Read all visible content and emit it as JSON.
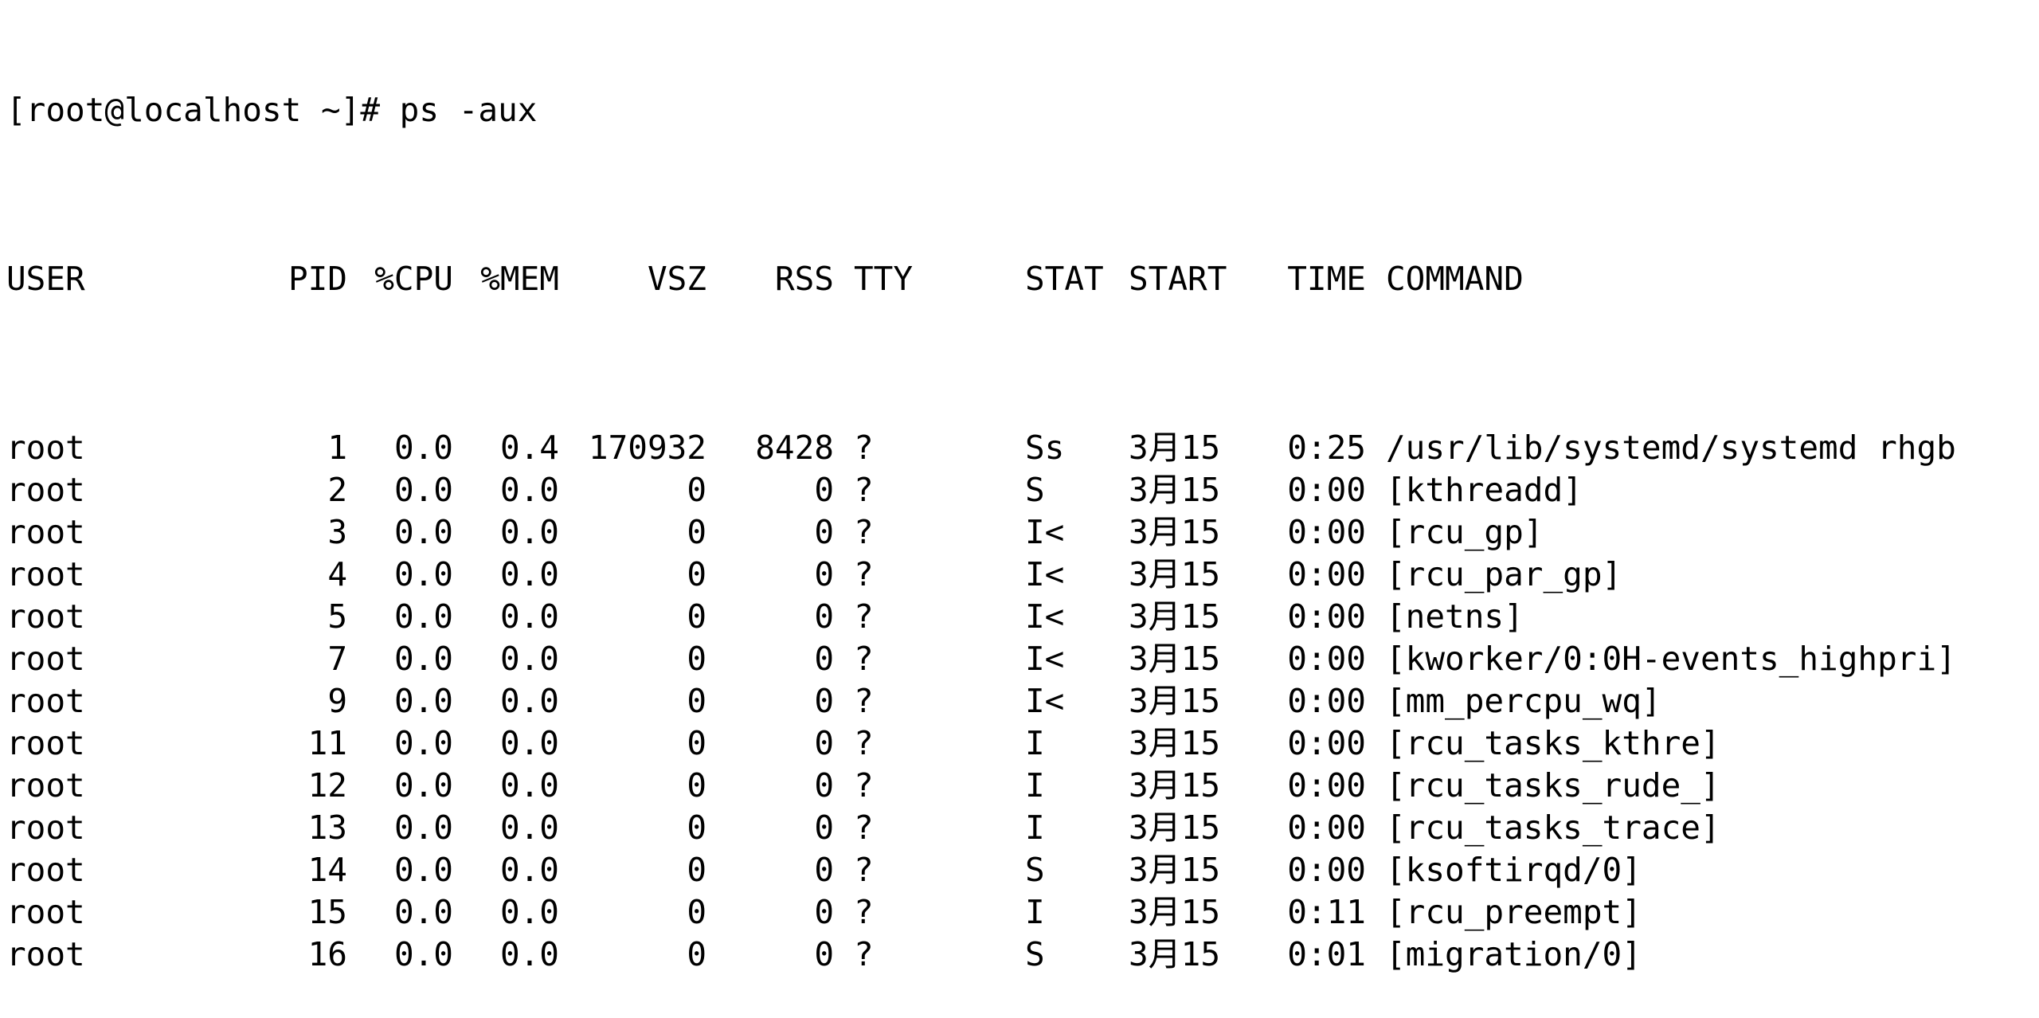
{
  "terminal": {
    "prompt": "[root@localhost ~]# ps -aux",
    "headers": {
      "user": "USER",
      "pid": "PID",
      "cpu": "%CPU",
      "mem": "%MEM",
      "vsz": "VSZ",
      "rss": "RSS",
      "tty": "TTY",
      "stat": "STAT",
      "start": "START",
      "time": "TIME",
      "command": "COMMAND"
    },
    "rows": [
      {
        "user": "root",
        "pid": "1",
        "cpu": "0.0",
        "mem": "0.4",
        "vsz": "170932",
        "rss": "8428",
        "tty": "?",
        "stat": "Ss",
        "start": "3月15",
        "time": "0:25",
        "command": "/usr/lib/systemd/systemd rhgb"
      },
      {
        "user": "root",
        "pid": "2",
        "cpu": "0.0",
        "mem": "0.0",
        "vsz": "0",
        "rss": "0",
        "tty": "?",
        "stat": "S",
        "start": "3月15",
        "time": "0:00",
        "command": "[kthreadd]"
      },
      {
        "user": "root",
        "pid": "3",
        "cpu": "0.0",
        "mem": "0.0",
        "vsz": "0",
        "rss": "0",
        "tty": "?",
        "stat": "I<",
        "start": "3月15",
        "time": "0:00",
        "command": "[rcu_gp]"
      },
      {
        "user": "root",
        "pid": "4",
        "cpu": "0.0",
        "mem": "0.0",
        "vsz": "0",
        "rss": "0",
        "tty": "?",
        "stat": "I<",
        "start": "3月15",
        "time": "0:00",
        "command": "[rcu_par_gp]"
      },
      {
        "user": "root",
        "pid": "5",
        "cpu": "0.0",
        "mem": "0.0",
        "vsz": "0",
        "rss": "0",
        "tty": "?",
        "stat": "I<",
        "start": "3月15",
        "time": "0:00",
        "command": "[netns]"
      },
      {
        "user": "root",
        "pid": "7",
        "cpu": "0.0",
        "mem": "0.0",
        "vsz": "0",
        "rss": "0",
        "tty": "?",
        "stat": "I<",
        "start": "3月15",
        "time": "0:00",
        "command": "[kworker/0:0H-events_highpri]"
      },
      {
        "user": "root",
        "pid": "9",
        "cpu": "0.0",
        "mem": "0.0",
        "vsz": "0",
        "rss": "0",
        "tty": "?",
        "stat": "I<",
        "start": "3月15",
        "time": "0:00",
        "command": "[mm_percpu_wq]"
      },
      {
        "user": "root",
        "pid": "11",
        "cpu": "0.0",
        "mem": "0.0",
        "vsz": "0",
        "rss": "0",
        "tty": "?",
        "stat": "I",
        "start": "3月15",
        "time": "0:00",
        "command": "[rcu_tasks_kthre]"
      },
      {
        "user": "root",
        "pid": "12",
        "cpu": "0.0",
        "mem": "0.0",
        "vsz": "0",
        "rss": "0",
        "tty": "?",
        "stat": "I",
        "start": "3月15",
        "time": "0:00",
        "command": "[rcu_tasks_rude_]"
      },
      {
        "user": "root",
        "pid": "13",
        "cpu": "0.0",
        "mem": "0.0",
        "vsz": "0",
        "rss": "0",
        "tty": "?",
        "stat": "I",
        "start": "3月15",
        "time": "0:00",
        "command": "[rcu_tasks_trace]"
      },
      {
        "user": "root",
        "pid": "14",
        "cpu": "0.0",
        "mem": "0.0",
        "vsz": "0",
        "rss": "0",
        "tty": "?",
        "stat": "S",
        "start": "3月15",
        "time": "0:00",
        "command": "[ksoftirqd/0]"
      },
      {
        "user": "root",
        "pid": "15",
        "cpu": "0.0",
        "mem": "0.0",
        "vsz": "0",
        "rss": "0",
        "tty": "?",
        "stat": "I",
        "start": "3月15",
        "time": "0:11",
        "command": "[rcu_preempt]"
      },
      {
        "user": "root",
        "pid": "16",
        "cpu": "0.0",
        "mem": "0.0",
        "vsz": "0",
        "rss": "0",
        "tty": "?",
        "stat": "S",
        "start": "3月15",
        "time": "0:01",
        "command": "[migration/0]"
      }
    ]
  }
}
